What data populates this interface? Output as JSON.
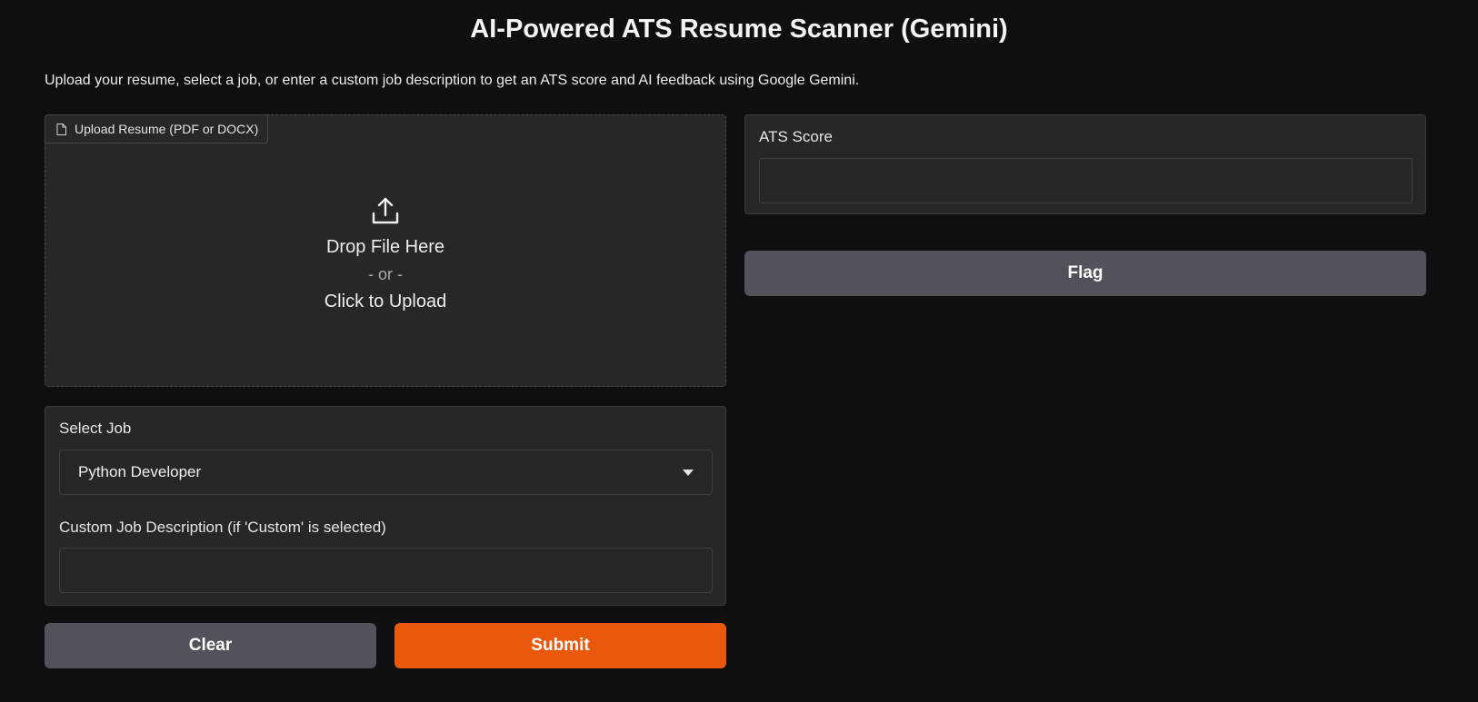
{
  "header": {
    "title": "AI-Powered ATS Resume Scanner (Gemini)",
    "description": "Upload your resume, select a job, or enter a custom job description to get an ATS score and AI feedback using Google Gemini."
  },
  "upload": {
    "label": "Upload Resume (PDF or DOCX)",
    "drop_text": "Drop File Here",
    "or_text": "- or -",
    "click_text": "Click to Upload"
  },
  "job_select": {
    "label": "Select Job",
    "selected": "Python Developer"
  },
  "custom_job": {
    "label": "Custom Job Description (if 'Custom' is selected)",
    "value": "",
    "placeholder": ""
  },
  "ats_score": {
    "label": "ATS Score",
    "value": ""
  },
  "buttons": {
    "clear": "Clear",
    "submit": "Submit",
    "flag": "Flag"
  },
  "colors": {
    "background": "#0f0f11",
    "panel": "#27272a",
    "primary": "#ea580c",
    "secondary": "#52525b"
  },
  "icons": {
    "upload_label_icon": "file-icon",
    "drop_zone_icon": "upload-icon",
    "select_icon": "chevron-down-icon"
  }
}
